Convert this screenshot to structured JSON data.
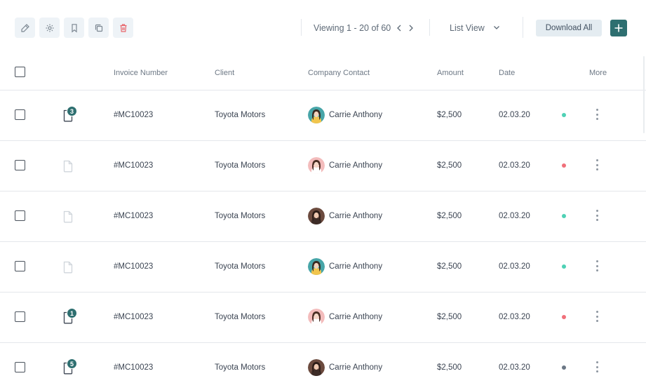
{
  "toolbar": {
    "actions": [
      {
        "icon": "edit-icon",
        "name": "edit-button"
      },
      {
        "icon": "gear-icon",
        "name": "settings-button"
      },
      {
        "icon": "bookmark-icon",
        "name": "bookmark-button"
      },
      {
        "icon": "copy-icon",
        "name": "copy-button"
      },
      {
        "icon": "trash-icon",
        "name": "delete-button",
        "color": "#e8646a"
      }
    ],
    "viewing_text": "Viewing 1 - 20 of 60",
    "view_mode": "List View",
    "download_label": "Download All",
    "accent_color": "#2e6f70"
  },
  "table": {
    "columns": [
      "Invoice Number",
      "Client",
      "Company Contact",
      "Amount",
      "Date",
      "More"
    ],
    "rows": [
      {
        "doc_active": true,
        "badge": "3",
        "invoice": "#MC10023",
        "client": "Toyota Motors",
        "avatar": "teal",
        "contact": "Carrie Anthony",
        "amount": "$2,500",
        "date": "02.03.20",
        "status_color": "#4fd1b5"
      },
      {
        "doc_active": false,
        "badge": "",
        "invoice": "#MC10023",
        "client": "Toyota Motors",
        "avatar": "pink",
        "contact": "Carrie Anthony",
        "amount": "$2,500",
        "date": "02.03.20",
        "status_color": "#f0707a"
      },
      {
        "doc_active": false,
        "badge": "",
        "invoice": "#MC10023",
        "client": "Toyota Motors",
        "avatar": "brown",
        "contact": "Carrie Anthony",
        "amount": "$2,500",
        "date": "02.03.20",
        "status_color": "#4fd1b5"
      },
      {
        "doc_active": false,
        "badge": "",
        "invoice": "#MC10023",
        "client": "Toyota Motors",
        "avatar": "teal",
        "contact": "Carrie Anthony",
        "amount": "$2,500",
        "date": "02.03.20",
        "status_color": "#4fd1b5"
      },
      {
        "doc_active": true,
        "badge": "1",
        "invoice": "#MC10023",
        "client": "Toyota Motors",
        "avatar": "pink",
        "contact": "Carrie Anthony",
        "amount": "$2,500",
        "date": "02.03.20",
        "status_color": "#f0707a"
      },
      {
        "doc_active": true,
        "badge": "5",
        "invoice": "#MC10023",
        "client": "Toyota Motors",
        "avatar": "brown",
        "contact": "Carrie Anthony",
        "amount": "$2,500",
        "date": "02.03.20",
        "status_color": "#6b7785"
      }
    ]
  }
}
